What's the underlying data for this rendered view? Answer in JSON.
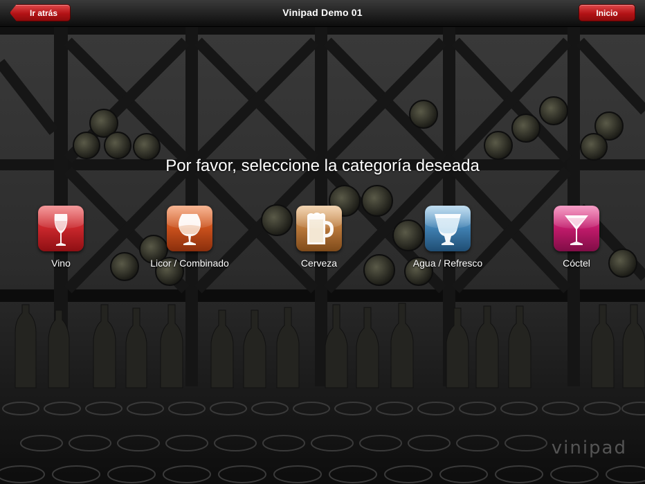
{
  "header": {
    "title": "Vinipad Demo 01",
    "back_label": "Ir atrás",
    "home_label": "Inicio"
  },
  "prompt": "Por favor, seleccione la categoría deseada",
  "categories": [
    {
      "label": "Vino",
      "icon": "wine-glass-icon",
      "color": "#c8262b"
    },
    {
      "label": "Licor / Combinado",
      "icon": "brandy-glass-icon",
      "color": "#c8501c"
    },
    {
      "label": "Cerveza",
      "icon": "beer-mug-icon",
      "color": "#b8773a"
    },
    {
      "label": "Agua / Refresco",
      "icon": "water-glass-icon",
      "color": "#3f7fb0"
    },
    {
      "label": "Cóctel",
      "icon": "cocktail-glass-icon",
      "color": "#c01a6a"
    }
  ],
  "watermark": "vinipad"
}
